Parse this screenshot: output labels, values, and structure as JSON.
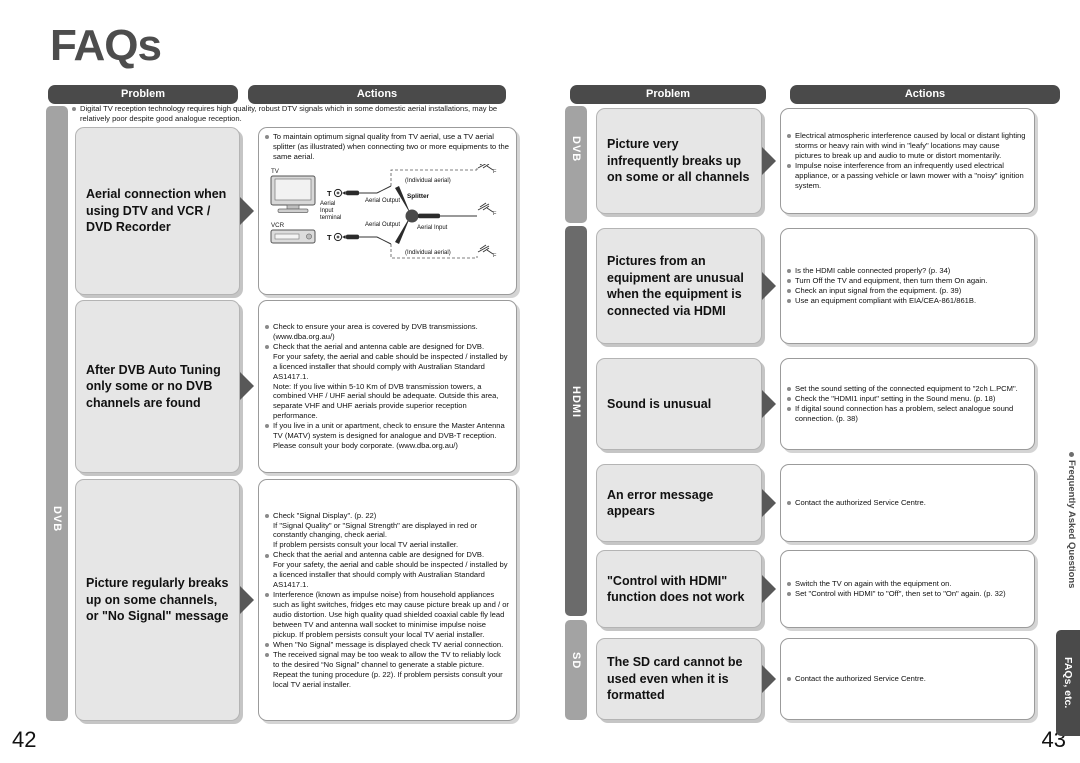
{
  "page": {
    "title": "FAQs",
    "folio_left": "42",
    "folio_right": "43",
    "edge_label": "Frequently Asked Questions",
    "edge_tab": "FAQs, etc."
  },
  "headers": {
    "problem": "Problem",
    "actions": "Actions"
  },
  "colors": {
    "header_bar": "#4a4a4a",
    "problem_cell": "#e6e6e6",
    "arrow": "#585858",
    "cat_dvb": "#a3a3a3",
    "cat_hdmi": "#6b6b6b",
    "cat_sd": "#a3a3a3"
  },
  "left_page": {
    "category": "DVB",
    "intro_note": "Digital TV reception technology requires high quality, robust DTV signals which in some domestic aerial installations, may be relatively poor despite good analogue reception.",
    "rows": [
      {
        "problem": "Aerial connection when using DTV and VCR / DVD Recorder",
        "actions": [
          "To maintain optimum signal quality from TV aerial, use a TV aerial splitter (as illustrated) when connecting two or more equipments to the same aerial."
        ],
        "diagram": {
          "tv_label": "TV",
          "vcr_label": "VCR",
          "aerial_input_terminal": "Aerial\nInput\nterminal",
          "aerial_output_top": "Aerial Output",
          "aerial_output_bottom": "Aerial Output",
          "splitter": "Splitter",
          "aerial_input": "Aerial Input",
          "individual_aerial_top": "(Individual aerial)",
          "individual_aerial_bottom": "(Individual aerial)"
        }
      },
      {
        "problem": "After DVB Auto Tuning only some or no DVB channels are found",
        "actions": [
          "Check to ensure your area is covered by DVB transmissions. (www.dba.org.au/)",
          "Check that the aerial and antenna cable are designed for DVB.\nFor your safety, the aerial and cable should be inspected / installed by a licenced installer that should comply with Australian Standard AS1417.1.\nNote: If you live within 5-10 Km of DVB transmission towers, a combined VHF / UHF aerial should be adequate. Outside this area, separate VHF and UHF aerials provide superior reception performance.",
          "If you live in a unit or apartment, check to ensure the Master Antenna TV (MATV) system is designed for analogue and DVB-T reception. Please consult your body corporate. (www.dba.org.au/)"
        ]
      },
      {
        "problem": "Picture regularly breaks up on some channels, or \"No Signal\" message",
        "actions": [
          "Check \"Signal Display\". (p. 22)\nIf \"Signal Quality\" or \"Signal Strength\" are displayed in red or constantly changing, check aerial.\nIf problem persists consult your local TV aerial installer.",
          "Check that the aerial and antenna cable are designed for DVB.\nFor your safety, the aerial and cable should be inspected / installed by a licenced installer that should comply with Australian Standard AS1417.1.",
          "Interference (known as impulse noise) from household appliances such as light switches, fridges etc may cause picture break up and / or audio distortion. Use high quality quad shielded coaxial cable fly lead between TV and antenna wall socket to minimise impulse noise pickup. If problem persists consult your local TV aerial installer.",
          "When \"No Signal\" message is displayed check TV aerial connection.",
          "The received signal may be too weak to allow the TV to reliably lock to the desired “No Signal” channel to generate a stable picture. Repeat the tuning procedure (p. 22). If problem persists consult your local TV aerial installer."
        ]
      }
    ]
  },
  "right_page": {
    "categories": [
      {
        "label": "DVB"
      },
      {
        "label": "HDMI"
      },
      {
        "label": "SD"
      }
    ],
    "rows": [
      {
        "category": "DVB",
        "problem": "Picture very infrequently breaks up on some or all channels",
        "actions": [
          "Electrical atmospheric interference caused by local or distant lighting storms or heavy rain with wind in \"leafy\" locations may cause pictures to break up and audio to mute or distort momentarily.",
          "Impulse noise interference from an infrequently used electrical appliance, or a passing vehicle or lawn mower with a \"noisy\" ignition system."
        ]
      },
      {
        "category": "HDMI",
        "problem": "Pictures from an equipment are unusual when the equipment is connected via HDMI",
        "actions": [
          "Is the HDMI cable connected properly? (p. 34)",
          "Turn Off the TV and equipment, then turn them On again.",
          "Check an input signal from the equipment. (p. 39)",
          "Use an equipment compliant with EIA/CEA-861/861B."
        ]
      },
      {
        "category": "HDMI",
        "problem": "Sound is unusual",
        "actions": [
          "Set the sound setting of the connected equipment to \"2ch L.PCM\".",
          "Check the \"HDMI1 input\" setting in the Sound menu. (p. 18)",
          "If digital sound connection has a problem, select analogue sound connection. (p. 38)"
        ]
      },
      {
        "category": "HDMI",
        "problem": "An error message appears",
        "actions": [
          "Contact the authorized Service Centre."
        ]
      },
      {
        "category": "HDMI",
        "problem": "\"Control with HDMI\" function does not work",
        "actions": [
          "Switch the TV on again with the equipment on.",
          "Set \"Control with HDMI\" to \"Off\", then set to \"On\" again. (p. 32)"
        ]
      },
      {
        "category": "SD",
        "problem": "The SD card cannot be used even when it is formatted",
        "actions": [
          "Contact the authorized Service Centre."
        ]
      }
    ]
  }
}
